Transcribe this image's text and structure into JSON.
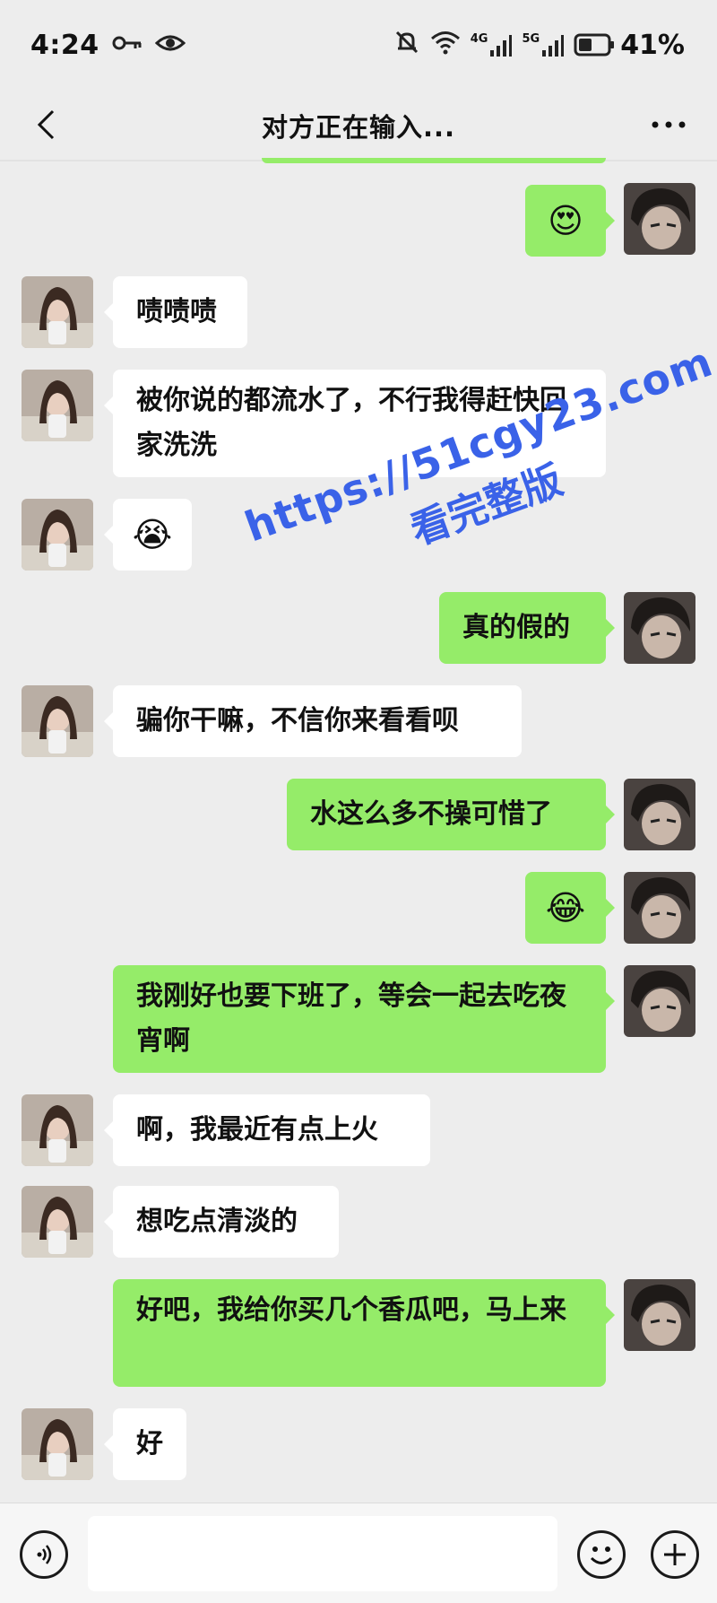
{
  "status_bar": {
    "time": "4:24",
    "network_1": "4G",
    "network_2": "5G",
    "battery_percent": "41%"
  },
  "nav": {
    "title": "对方正在输入..."
  },
  "messages": [
    {
      "side": "out",
      "type": "emoji",
      "emoji": "😍"
    },
    {
      "side": "in",
      "type": "text",
      "text": "啧啧啧"
    },
    {
      "side": "in",
      "type": "text",
      "text": "被你说的都流水了，不行我得赶快回家洗洗"
    },
    {
      "side": "in",
      "type": "emoji",
      "emoji": "😭"
    },
    {
      "side": "out",
      "type": "text",
      "text": "真的假的"
    },
    {
      "side": "in",
      "type": "text",
      "text": "骗你干嘛，不信你来看看呗"
    },
    {
      "side": "out",
      "type": "text",
      "text": "水这么多不操可惜了"
    },
    {
      "side": "out",
      "type": "emoji",
      "emoji": "😂"
    },
    {
      "side": "out",
      "type": "text",
      "text": "我刚好也要下班了，等会一起去吃夜宵啊"
    },
    {
      "side": "in",
      "type": "text",
      "text": "啊，我最近有点上火"
    },
    {
      "side": "in",
      "type": "text",
      "text": "想吃点清淡的"
    },
    {
      "side": "out",
      "type": "text",
      "text": "好吧，我给你买几个香瓜吧，马上来"
    },
    {
      "side": "in",
      "type": "text",
      "text": "好"
    }
  ],
  "watermark": {
    "url": "https://51cgy23.com",
    "subtitle": "看完整版"
  },
  "input_bar": {
    "placeholder": ""
  },
  "colors": {
    "background": "#ededed",
    "outgoing_bubble": "#95ec69",
    "incoming_bubble": "#ffffff",
    "watermark": "#3a62e8"
  }
}
